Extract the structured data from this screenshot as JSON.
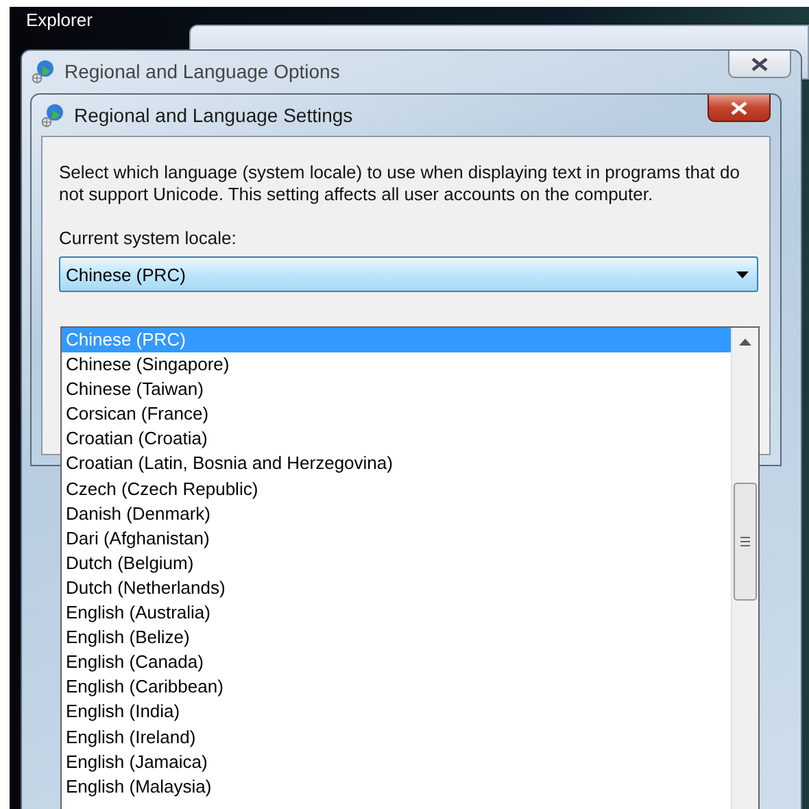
{
  "desktop": {
    "label": "Explorer"
  },
  "outer_window": {
    "title": "Regional and Language Options"
  },
  "dialog": {
    "title": "Regional and Language Settings",
    "description": "Select which language (system locale) to use when displaying text in programs that do not support Unicode. This setting affects all user accounts on the computer.",
    "locale_label": "Current system locale:",
    "locale_value": "Chinese (PRC)"
  },
  "locale_list": {
    "items": [
      {
        "label": "Chinese (PRC)",
        "selected": true
      },
      {
        "label": "Chinese (Singapore)",
        "selected": false
      },
      {
        "label": "Chinese (Taiwan)",
        "selected": false
      },
      {
        "label": "Corsican (France)",
        "selected": false
      },
      {
        "label": "Croatian (Croatia)",
        "selected": false
      },
      {
        "label": "Croatian (Latin, Bosnia and Herzegovina)",
        "selected": false
      },
      {
        "label": "Czech (Czech Republic)",
        "selected": false
      },
      {
        "label": "Danish (Denmark)",
        "selected": false
      },
      {
        "label": "Dari (Afghanistan)",
        "selected": false
      },
      {
        "label": "Dutch (Belgium)",
        "selected": false
      },
      {
        "label": "Dutch (Netherlands)",
        "selected": false
      },
      {
        "label": "English (Australia)",
        "selected": false
      },
      {
        "label": "English (Belize)",
        "selected": false
      },
      {
        "label": "English (Canada)",
        "selected": false
      },
      {
        "label": "English (Caribbean)",
        "selected": false
      },
      {
        "label": "English (India)",
        "selected": false
      },
      {
        "label": "English (Ireland)",
        "selected": false
      },
      {
        "label": "English (Jamaica)",
        "selected": false
      },
      {
        "label": "English (Malaysia)",
        "selected": false
      }
    ]
  }
}
